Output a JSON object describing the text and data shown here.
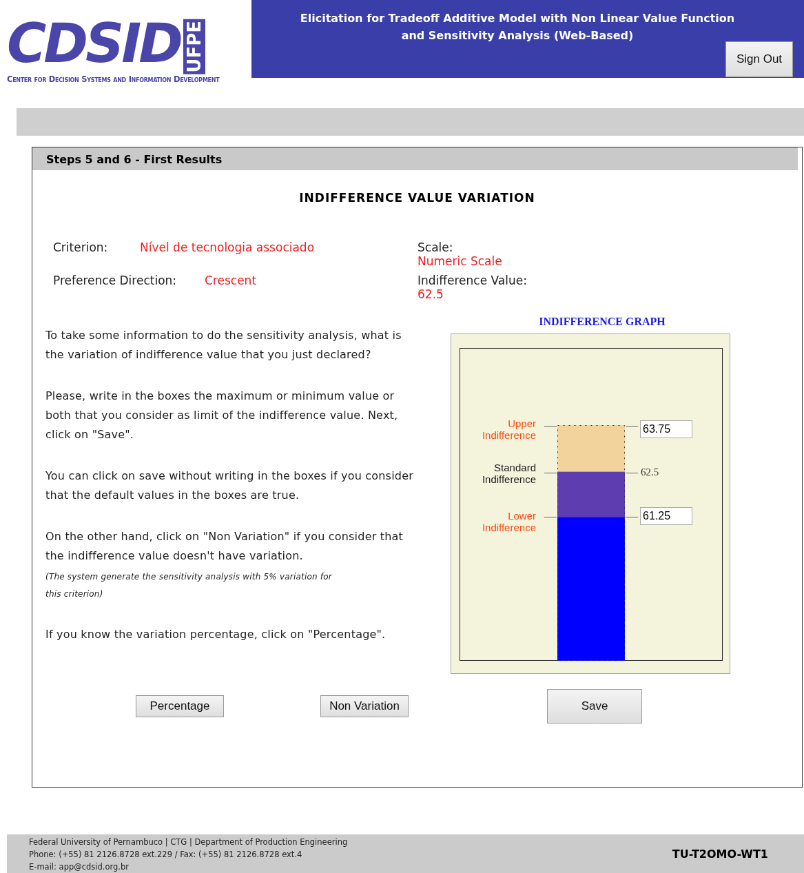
{
  "header": {
    "logo_letters": "CDSID",
    "logo_badge": "UFPE",
    "logo_tagline": "Center for Decision Systems and Information Development",
    "title": "Elicitation for Tradeoff Additive Model with Non Linear Value Function and Sensitivity Analysis (Web-Based)",
    "sign_out": "Sign Out"
  },
  "panel": {
    "title": "Steps 5 and 6 - First Results",
    "heading": "INDIFFERENCE VALUE VARIATION",
    "info": [
      {
        "label": "Criterion:",
        "value": "Nível de tecnologia associado"
      },
      {
        "label": "Scale:",
        "value": "Numeric Scale"
      },
      {
        "label": "Preference Direction:",
        "value": "Crescent"
      },
      {
        "label": "Indifference Value:",
        "value": "62.5"
      }
    ],
    "paragraphs": [
      {
        "kind": "text",
        "text": "To take some information to do the sensitivity analysis, what is the variation of indifference value that you just declared?"
      },
      {
        "kind": "text",
        "text": "Please, write in the boxes the maximum or minimum value or both that you consider as limit of the indifference value. Next, click on \"Save\"."
      },
      {
        "kind": "text",
        "text": "You can click on save without writing in the boxes if you consider that the default values in the boxes are true."
      },
      {
        "kind": "text",
        "text": "On the other hand, click on \"Non Variation\" if you consider that the indifference value doesn't have variation."
      },
      {
        "kind": "note",
        "text": "(The system generate the sensitivity analysis with 5% variation for this criterion)"
      },
      {
        "kind": "text",
        "text": "If you know the variation percentage, click on \"Percentage\"."
      }
    ],
    "graph": {
      "title": "INDIFFERENCE GRAPH",
      "upper_label": "Upper Indifference",
      "upper_value": "63.75",
      "standard_label": "Standard Indifference",
      "standard_value": "62.5",
      "lower_label": "Lower Indifference",
      "lower_value": "61.25"
    },
    "buttons": [
      "Percentage",
      "Non Variation",
      "Save"
    ]
  },
  "footer": {
    "lines": [
      "Federal University of Pernambuco | CTG | Department of Production Engineering",
      "Phone: (+55) 81 2126.8728 ext.229 / Fax: (+55) 81 2126.8728 ext.4",
      "E-mail: app@cdsid.org.br"
    ],
    "code": "TU-T2OMO-WT1"
  }
}
